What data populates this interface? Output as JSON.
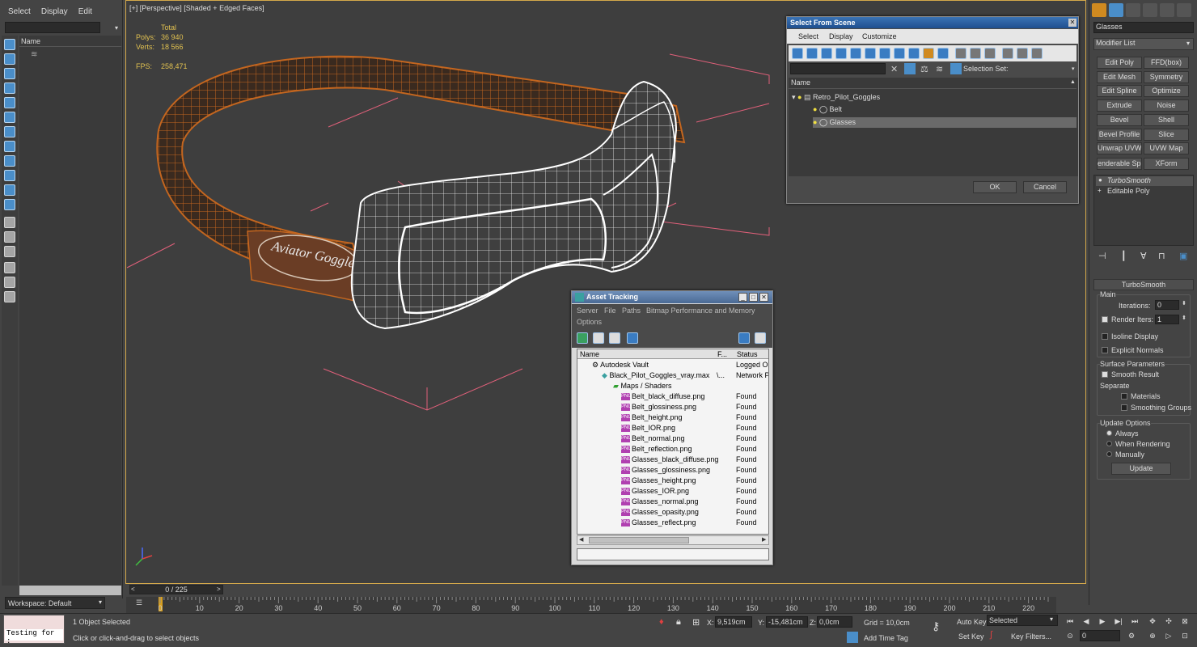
{
  "explorer": {
    "menu": [
      "Select",
      "Display",
      "Edit"
    ],
    "column_name": "Name",
    "workspace": "Workspace: Default"
  },
  "viewport": {
    "label": "[+] [Perspective] [Shaded + Edged Faces]",
    "stats": {
      "total_label": "Total",
      "polys_label": "Polys:",
      "polys_value": "36 940",
      "verts_label": "Verts:",
      "verts_value": "18 566",
      "fps_label": "FPS:",
      "fps_value": "258,471"
    },
    "belt_logo": "Aviator Goggle"
  },
  "select_from_scene": {
    "title": "Select From Scene",
    "menu": [
      "Select",
      "Display",
      "Customize"
    ],
    "selection_set_label": "Selection Set:",
    "column_name": "Name",
    "tree": [
      {
        "label": "Retro_Pilot_Goggles",
        "level": 0
      },
      {
        "label": "Belt",
        "level": 1
      },
      {
        "label": "Glasses",
        "level": 1,
        "selected": true
      }
    ],
    "ok": "OK",
    "cancel": "Cancel"
  },
  "asset_tracking": {
    "title": "Asset Tracking",
    "menu": [
      "Server",
      "File",
      "Paths",
      "Bitmap Performance and Memory",
      "Options"
    ],
    "columns": [
      "Name",
      "F...",
      "Status"
    ],
    "rows": [
      {
        "name": "Autodesk Vault",
        "f": "",
        "status": "Logged Out",
        "indent": 1,
        "icon": "vault"
      },
      {
        "name": "Black_Pilot_Goggles_vray.max",
        "f": "\\...",
        "status": "Network Path",
        "indent": 2,
        "icon": "max"
      },
      {
        "name": "Maps / Shaders",
        "f": "",
        "status": "",
        "indent": 3,
        "icon": "maps"
      },
      {
        "name": "Belt_black_diffuse.png",
        "f": "",
        "status": "Found",
        "indent": 4,
        "icon": "png"
      },
      {
        "name": "Belt_glossiness.png",
        "f": "",
        "status": "Found",
        "indent": 4,
        "icon": "png"
      },
      {
        "name": "Belt_height.png",
        "f": "",
        "status": "Found",
        "indent": 4,
        "icon": "png"
      },
      {
        "name": "Belt_IOR.png",
        "f": "",
        "status": "Found",
        "indent": 4,
        "icon": "png"
      },
      {
        "name": "Belt_normal.png",
        "f": "",
        "status": "Found",
        "indent": 4,
        "icon": "png"
      },
      {
        "name": "Belt_reflection.png",
        "f": "",
        "status": "Found",
        "indent": 4,
        "icon": "png"
      },
      {
        "name": "Glasses_black_diffuse.png",
        "f": "",
        "status": "Found",
        "indent": 4,
        "icon": "png"
      },
      {
        "name": "Glasses_glossiness.png",
        "f": "",
        "status": "Found",
        "indent": 4,
        "icon": "png"
      },
      {
        "name": "Glasses_height.png",
        "f": "",
        "status": "Found",
        "indent": 4,
        "icon": "png"
      },
      {
        "name": "Glasses_IOR.png",
        "f": "",
        "status": "Found",
        "indent": 4,
        "icon": "png"
      },
      {
        "name": "Glasses_normal.png",
        "f": "",
        "status": "Found",
        "indent": 4,
        "icon": "png"
      },
      {
        "name": "Glasses_opasity.png",
        "f": "",
        "status": "Found",
        "indent": 4,
        "icon": "png"
      },
      {
        "name": "Glasses_reflect.png",
        "f": "",
        "status": "Found",
        "indent": 4,
        "icon": "png"
      }
    ],
    "png_tag": "PNG"
  },
  "command_panel": {
    "object_name": "Glasses",
    "modifier_list": "Modifier List",
    "modifier_buttons": [
      "Edit Poly",
      "FFD(box)",
      "Edit Mesh",
      "Symmetry",
      "Edit Spline",
      "Optimize",
      "Extrude",
      "Noise",
      "Bevel",
      "Shell",
      "Bevel Profile",
      "Slice",
      "Unwrap UVW",
      "UVW Map",
      "enderable Splin",
      "XForm"
    ],
    "stack": [
      "TurboSmooth",
      "Editable Poly"
    ],
    "rollout": {
      "title": "TurboSmooth",
      "main": "Main",
      "iterations_label": "Iterations:",
      "iterations": "0",
      "render_iters_label": "Render Iters:",
      "render_iters": "1",
      "isoline": "Isoline Display",
      "explicit_normals": "Explicit Normals",
      "surface_params": "Surface Parameters",
      "smooth_result": "Smooth Result",
      "separate": "Separate",
      "materials": "Materials",
      "smoothing_groups": "Smoothing Groups",
      "update_options": "Update Options",
      "always": "Always",
      "when_rendering": "When Rendering",
      "manually": "Manually",
      "update": "Update"
    }
  },
  "timeline": {
    "slider": "0 / 225",
    "ticks": [
      "0",
      "10",
      "20",
      "30",
      "40",
      "50",
      "60",
      "70",
      "80",
      "90",
      "100",
      "110",
      "120",
      "130",
      "140",
      "150",
      "160",
      "170",
      "180",
      "190",
      "200",
      "210",
      "220"
    ]
  },
  "status_bar": {
    "script_text": "Testing for :",
    "selected": "1 Object Selected",
    "prompt": "Click or click-and-drag to select objects",
    "x_label": "X:",
    "x": "9,519cm",
    "y_label": "Y:",
    "y": "-15,481cm",
    "z_label": "Z:",
    "z": "0,0cm",
    "grid": "Grid = 10,0cm",
    "add_time_tag": "Add Time Tag",
    "auto_key": "Auto Key",
    "auto_key_sel": "Selected",
    "set_key": "Set Key",
    "key_filters": "Key Filters...",
    "frame": "0"
  }
}
